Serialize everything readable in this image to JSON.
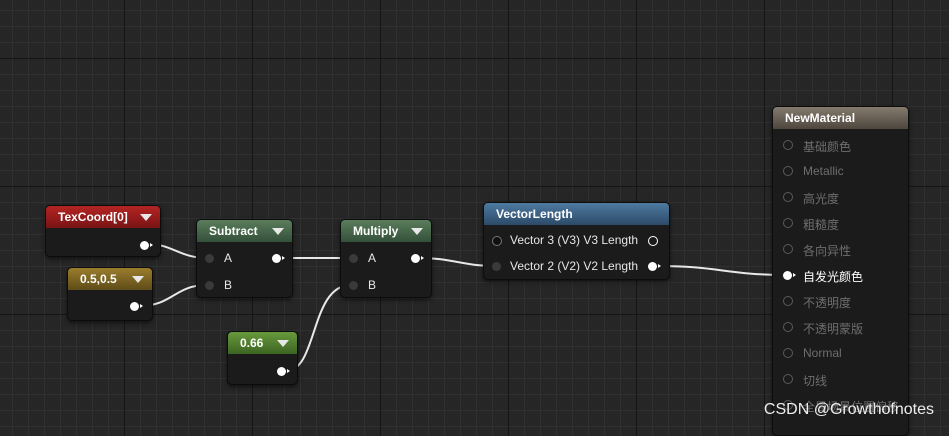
{
  "graph": {
    "texcoord": {
      "title": "TexCoord[0]"
    },
    "const2": {
      "title": "0.5,0.5"
    },
    "subtract": {
      "title": "Subtract",
      "in_a": "A",
      "in_b": "B"
    },
    "multiply": {
      "title": "Multiply",
      "in_a": "A",
      "in_b": "B"
    },
    "const1": {
      "title": "0.66"
    },
    "vectorlength": {
      "title": "VectorLength",
      "pin1": "Vector 3 (V3) V3 Length",
      "pin2": "Vector 2 (V2) V2 Length"
    },
    "material": {
      "title": "NewMaterial",
      "inputs": [
        {
          "label": "基础颜色"
        },
        {
          "label": "Metallic"
        },
        {
          "label": "高光度"
        },
        {
          "label": "粗糙度"
        },
        {
          "label": "各向异性"
        },
        {
          "label": "自发光颜色"
        },
        {
          "label": "不透明度"
        },
        {
          "label": "不透明蒙版"
        },
        {
          "label": "Normal"
        },
        {
          "label": "切线"
        },
        {
          "label": "全局场景位置偏移"
        }
      ]
    }
  },
  "colors": {
    "texcoord": "#9a1c1c",
    "constant": "#7a6422",
    "math": "#4a6a4c",
    "scalar": "#4f7a30",
    "vector": "#3c5e80",
    "material": "#6b6358"
  },
  "watermark": "CSDN @Growthofnotes"
}
